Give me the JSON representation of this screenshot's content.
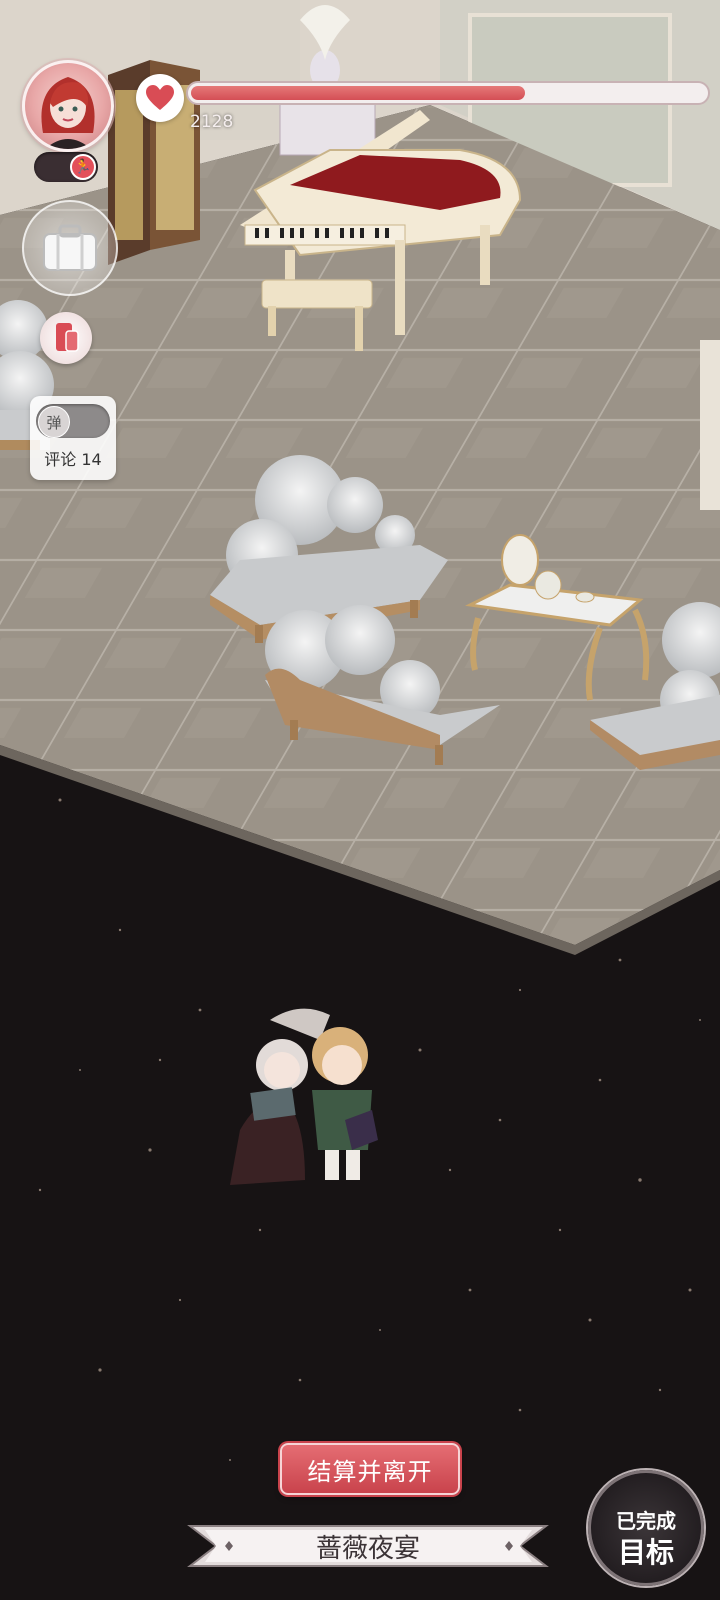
{
  "hud": {
    "progress_value": "2128",
    "progress_fill": 0.65,
    "danmu_label": "弹",
    "comments_label": "评论 14"
  },
  "bottom": {
    "settle_button": "结算并离开",
    "scene_title": "蔷薇夜宴",
    "goal_line1": "已完成",
    "goal_line2": "目标"
  },
  "colors": {
    "accent_red": "#d44e55",
    "floor": "#9c948a",
    "void": "#171314"
  }
}
